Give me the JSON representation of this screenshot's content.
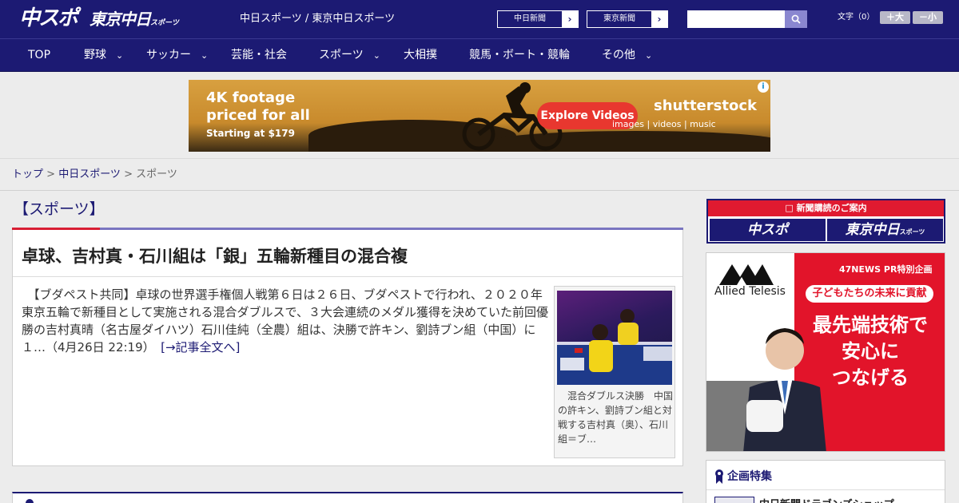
{
  "header": {
    "logo_chuspo": "中スポ",
    "logo_tokyo": "東京中日",
    "logo_tokyo_small": "スポーツ",
    "site_links": "中日スポーツ / 東京中日スポーツ",
    "paper1": "中日新聞",
    "paper2": "東京新聞",
    "search_placeholder": "",
    "font_label": "文字（0）",
    "font_big": "＋大",
    "font_small": "－小"
  },
  "nav": {
    "items": [
      {
        "label": "TOP",
        "dropdown": false
      },
      {
        "label": "野球",
        "dropdown": true
      },
      {
        "label": "サッカー",
        "dropdown": true
      },
      {
        "label": "芸能・社会",
        "dropdown": false
      },
      {
        "label": "スポーツ",
        "dropdown": true
      },
      {
        "label": "大相撲",
        "dropdown": false
      },
      {
        "label": "競馬・ボート・競輪",
        "dropdown": false
      },
      {
        "label": "その他",
        "dropdown": true
      }
    ]
  },
  "ad_top": {
    "headline1": "4K footage",
    "headline2": "priced for all",
    "sub": "Starting at $179",
    "cta": "Explore Videos",
    "brand": "shutterstock",
    "brand_sub": "images  |  videos  |  music",
    "info": "i"
  },
  "breadcrumb": {
    "home": "トップ",
    "sep": " > ",
    "parent": "中日スポーツ",
    "current": "スポーツ"
  },
  "section": {
    "title": "【スポーツ】"
  },
  "article": {
    "title": "卓球、吉村真・石川組は「銀」五輪新種目の混合複",
    "body": "　【ブダペスト共同】卓球の世界選手権個人戦第６日は２６日、ブダペストで行われ、２０２０年東京五輪で新種目として実施される混合ダブルスで、３大会連続のメダル獲得を決めていた前回優勝の吉村真晴（名古屋ダイハツ）石川佳純（全農）組は、決勝で許キン、劉詩ブン組（中国）に１…（4月26日 22:19）　",
    "more": "[→記事全文へ]",
    "caption": "　混合ダブルス決勝　中国の許キン、劉詩ブン組と対戦する吉村真（奥）、石川組＝ブ…"
  },
  "sidebar": {
    "subscribe_head": "新聞購読のご案内",
    "sub_chuspo": "中スポ",
    "sub_tokyo": "東京中日",
    "sub_tokyo_small": "スポーツ",
    "ad": {
      "brand": "Allied Telesis",
      "pr": "47NEWS PR特別企画",
      "pill": "子どもたちの未来に貢献",
      "line1": "最先端技術で",
      "line2": "安心に",
      "line3": "つなげる"
    },
    "feature_title": "企画特集",
    "feature_item": "中日新聞ドラゴンズショップ"
  },
  "colors": {
    "brand_navy": "#1c1a73",
    "accent_red": "#d81e34",
    "nav_line": "#7a75c0"
  }
}
